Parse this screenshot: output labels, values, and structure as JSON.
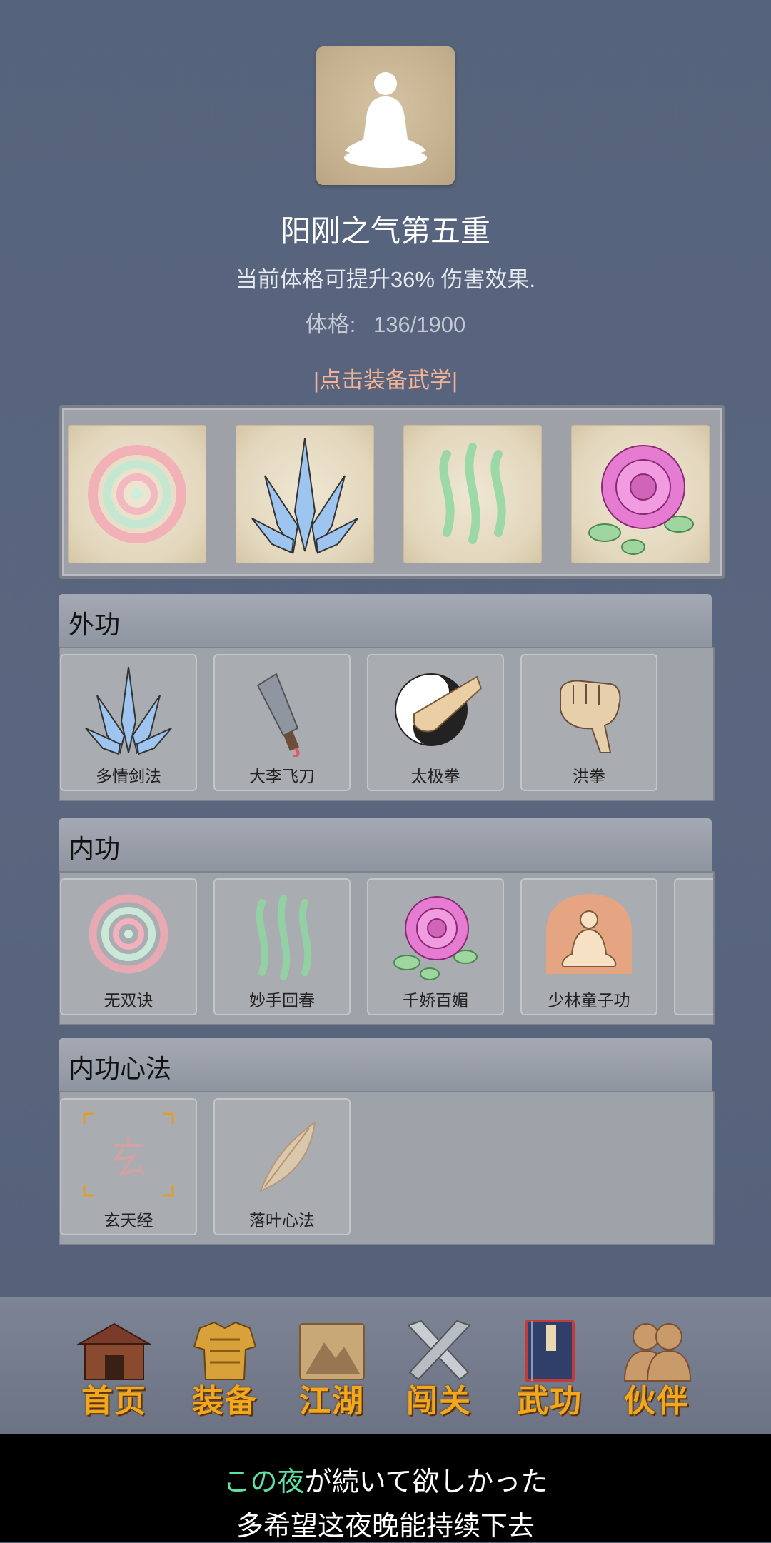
{
  "header": {
    "portrait_icon": "meditating-figure-icon",
    "realm_title": "阳刚之气第五重",
    "realm_desc": "当前体格可提升36% 伤害效果.",
    "stat_label": "体格:",
    "stat_value": "136/1900",
    "equip_hint": "|点击装备武学|"
  },
  "equipped": [
    {
      "icon": "swirl-icon"
    },
    {
      "icon": "crystal-blades-icon"
    },
    {
      "icon": "green-wisps-icon"
    },
    {
      "icon": "rose-icon"
    }
  ],
  "sections": {
    "waigong": {
      "title": "外功",
      "items": [
        {
          "name": "多情剑法",
          "icon": "crystal-blades-icon"
        },
        {
          "name": "大李飞刀",
          "icon": "flying-knife-icon"
        },
        {
          "name": "太极拳",
          "icon": "taiji-fist-icon"
        },
        {
          "name": "洪拳",
          "icon": "fist-icon"
        }
      ]
    },
    "neigong": {
      "title": "内功",
      "items": [
        {
          "name": "无双诀",
          "icon": "swirl-icon"
        },
        {
          "name": "妙手回春",
          "icon": "green-wisps-icon"
        },
        {
          "name": "千娇百媚",
          "icon": "rose-icon"
        },
        {
          "name": "少林童子功",
          "icon": "meditating-monk-icon"
        }
      ]
    },
    "xinfa": {
      "title": "内功心法",
      "items": [
        {
          "name": "玄天经",
          "icon": "xuan-scroll-icon"
        },
        {
          "name": "落叶心法",
          "icon": "leaf-icon"
        }
      ]
    }
  },
  "nav": [
    {
      "label": "首页",
      "icon": "house-icon"
    },
    {
      "label": "装备",
      "icon": "armor-icon"
    },
    {
      "label": "江湖",
      "icon": "mountain-scroll-icon"
    },
    {
      "label": "闯关",
      "icon": "crossed-swords-icon"
    },
    {
      "label": "武功",
      "icon": "book-icon"
    },
    {
      "label": "伙伴",
      "icon": "partners-icon"
    }
  ],
  "subtitle": {
    "line1_highlight": "この夜",
    "line1_rest": "が続いて欲しかった",
    "line2": "多希望这夜晚能持续下去"
  },
  "colors": {
    "background": "#56637c",
    "hint": "#f3b394",
    "nav_text": "#f2a81c",
    "subtitle_highlight": "#5fe0a4"
  }
}
